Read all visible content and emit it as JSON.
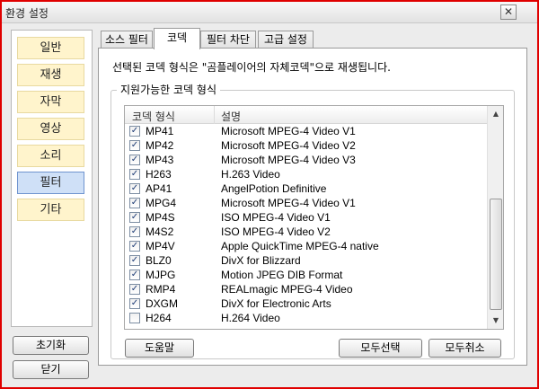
{
  "window": {
    "title": "환경 설정",
    "close_glyph": "✕"
  },
  "sidebar": {
    "items": [
      {
        "label": "일반",
        "active": false
      },
      {
        "label": "재생",
        "active": false
      },
      {
        "label": "자막",
        "active": false
      },
      {
        "label": "영상",
        "active": false
      },
      {
        "label": "소리",
        "active": false
      },
      {
        "label": "필터",
        "active": true
      },
      {
        "label": "기타",
        "active": false
      }
    ],
    "reset_label": "초기화",
    "close_label": "닫기"
  },
  "tabs": [
    {
      "label": "소스 필터",
      "active": false
    },
    {
      "label": "코덱",
      "active": true
    },
    {
      "label": "필터 차단",
      "active": false
    },
    {
      "label": "고급 설정",
      "active": false
    }
  ],
  "codec_panel": {
    "description": "선택된 코덱 형식은 \"곰플레이어의 자체코덱\"으로 재생됩니다.",
    "group_title": "지원가능한 코덱 형식",
    "columns": [
      "코덱 형식",
      "설명"
    ],
    "rows": [
      {
        "code": "MP41",
        "desc": "Microsoft MPEG-4 Video V1",
        "checked": true
      },
      {
        "code": "MP42",
        "desc": "Microsoft MPEG-4 Video V2",
        "checked": true
      },
      {
        "code": "MP43",
        "desc": "Microsoft MPEG-4 Video V3",
        "checked": true
      },
      {
        "code": "H263",
        "desc": "H.263 Video",
        "checked": true
      },
      {
        "code": "AP41",
        "desc": "AngelPotion Definitive",
        "checked": true
      },
      {
        "code": "MPG4",
        "desc": "Microsoft MPEG-4 Video V1",
        "checked": true
      },
      {
        "code": "MP4S",
        "desc": "ISO MPEG-4 Video V1",
        "checked": true
      },
      {
        "code": "M4S2",
        "desc": "ISO MPEG-4 Video V2",
        "checked": true
      },
      {
        "code": "MP4V",
        "desc": "Apple QuickTime MPEG-4 native",
        "checked": true
      },
      {
        "code": "BLZ0",
        "desc": "DivX for Blizzard",
        "checked": true
      },
      {
        "code": "MJPG",
        "desc": "Motion JPEG DIB Format",
        "checked": true
      },
      {
        "code": "RMP4",
        "desc": "REALmagic MPEG-4 Video",
        "checked": true
      },
      {
        "code": "DXGM",
        "desc": "DivX for Electronic Arts",
        "checked": true
      },
      {
        "code": "H264",
        "desc": "H.264 Video",
        "checked": false
      }
    ],
    "help_label": "도움말",
    "select_all_label": "모두선택",
    "deselect_all_label": "모두취소",
    "check_glyph": "✓",
    "scroll_up_glyph": "▲",
    "scroll_down_glyph": "▼"
  }
}
